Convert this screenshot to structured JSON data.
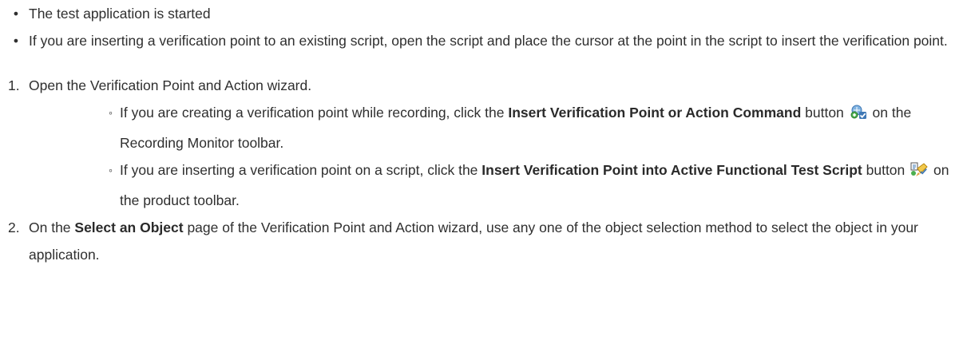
{
  "prereqs": [
    "The test application is started",
    "If you are inserting a verification point to an existing script, open the script and place the cursor at the point in the script to insert the verification point."
  ],
  "steps": {
    "s1": {
      "num": "1.",
      "text": "Open the Verification Point and Action wizard.",
      "sub1": {
        "pre": "If you are creating a verification point while recording, click the ",
        "bold": "Insert Verification Point or Action Command",
        "mid": " button ",
        "icon": "insert-verification-point-action-icon",
        "post": " on the Recording Monitor toolbar."
      },
      "sub2": {
        "pre": "If you are inserting a verification point on a script, click the ",
        "bold": "Insert Verification Point into Active Functional Test Script",
        "mid": " button ",
        "icon": "insert-verification-point-script-icon",
        "post": " on the product toolbar."
      }
    },
    "s2": {
      "num": "2.",
      "pre": "On the ",
      "bold": "Select an Object",
      "post": " page of the Verification Point and Action wizard, use any one of the object selection method to select the object in your application."
    }
  }
}
